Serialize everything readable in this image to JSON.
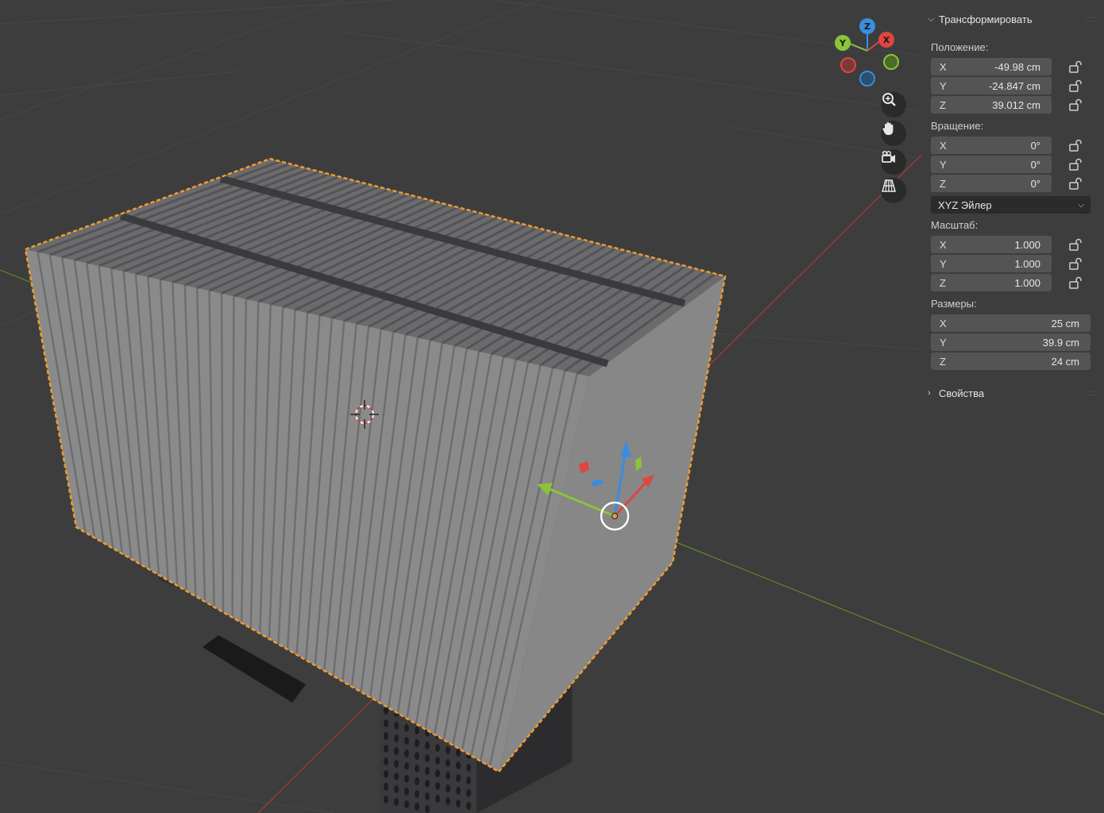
{
  "gizmo": {
    "axes": [
      "Z",
      "Y",
      "X"
    ],
    "colors": {
      "x": "#e0453f",
      "y": "#8bc43a",
      "z": "#3a8de0"
    }
  },
  "nav_buttons": [
    "zoom-icon",
    "pan-hand-icon",
    "camera-icon",
    "grid-projection-icon"
  ],
  "panel": {
    "transform_header": "Трансформировать",
    "location_label": "Положение:",
    "location": [
      {
        "axis": "X",
        "value": "-49.98 cm"
      },
      {
        "axis": "Y",
        "value": "-24.847 cm"
      },
      {
        "axis": "Z",
        "value": "39.012 cm"
      }
    ],
    "rotation_label": "Вращение:",
    "rotation": [
      {
        "axis": "X",
        "value": "0°"
      },
      {
        "axis": "Y",
        "value": "0°"
      },
      {
        "axis": "Z",
        "value": "0°"
      }
    ],
    "rotation_mode": "XYZ Эйлер",
    "scale_label": "Масштаб:",
    "scale": [
      {
        "axis": "X",
        "value": "1.000"
      },
      {
        "axis": "Y",
        "value": "1.000"
      },
      {
        "axis": "Z",
        "value": "1.000"
      }
    ],
    "dimensions_label": "Размеры:",
    "dimensions": [
      {
        "axis": "X",
        "value": "25 cm"
      },
      {
        "axis": "Y",
        "value": "39.9 cm"
      },
      {
        "axis": "Z",
        "value": "24 cm"
      }
    ],
    "properties_header": "Свойства"
  },
  "colors": {
    "selection_outline": "#f29b2e",
    "panel_field": "#545454",
    "background": "#3d3d3d"
  }
}
